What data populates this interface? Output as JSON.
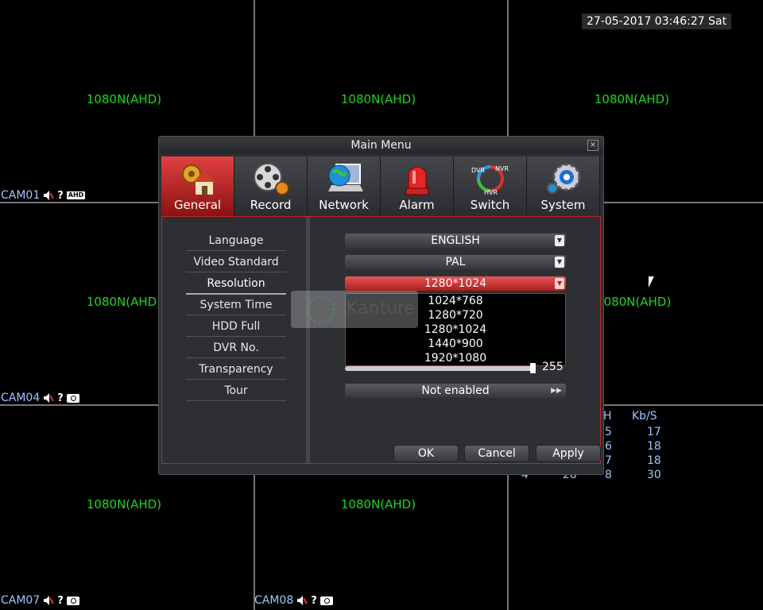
{
  "datetime": "27-05-2017 03:46:27 Sat",
  "channels": [
    {
      "res": "1080N(AHD)"
    },
    {
      "res": "1080N(AHD)"
    },
    {
      "res": "1080N(AHD)"
    },
    {
      "res": "1080N(AHD)"
    },
    {
      "res": "080N(AHD)"
    },
    {
      "res": "1080N(AHD)"
    },
    {
      "res": "1080N(AHD)"
    }
  ],
  "cam_labels": {
    "cam01": "CAM01",
    "cam04": "CAM04",
    "cam07": "CAM07",
    "cam08": "CAM08",
    "ahd": "AHD",
    "q": "?"
  },
  "stats": {
    "h_header": "H",
    "kbs_header": "Kb/S",
    "rows": [
      [
        "5",
        "17"
      ],
      [
        "6",
        "18"
      ],
      [
        "7",
        "18"
      ],
      [
        "8",
        "30"
      ]
    ],
    "last_row_partial": [
      "4",
      "28"
    ]
  },
  "window": {
    "title": "Main Menu",
    "close": "×"
  },
  "tabs": [
    "General",
    "Record",
    "Network",
    "Alarm",
    "Switch",
    "System"
  ],
  "switch_icon_text": {
    "dvr": "DVR",
    "nvr": "NVR",
    "hvr": "HVR"
  },
  "menu_items": [
    "Language",
    "Video Standard",
    "Resolution",
    "System Time",
    "HDD Full",
    "DVR No.",
    "Transparency",
    "Tour"
  ],
  "fields": {
    "language": "ENGLISH",
    "video_standard": "PAL",
    "resolution": "1280*1024",
    "resolution_options": [
      "1024*768",
      "1280*720",
      "1280*1024",
      "1440*900",
      "1920*1080"
    ],
    "transparency_value": "255",
    "tour": "Not enabled",
    "tour_arrow": "▶▶",
    "dropdown_arrow": "▼"
  },
  "buttons": {
    "ok": "OK",
    "cancel": "Cancel",
    "apply": "Apply"
  },
  "watermark": "Kanture",
  "colors": {
    "accent_red": "#c02828",
    "res_green": "#1ed61e",
    "cam_blue": "#9fc6ff"
  }
}
